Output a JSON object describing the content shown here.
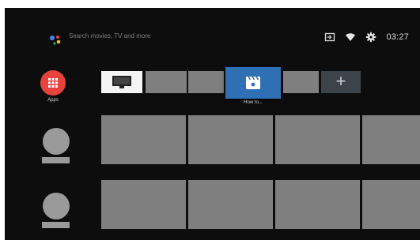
{
  "search": {
    "hint": "Search movies, TV and more"
  },
  "status": {
    "time": "03:27"
  },
  "apps": {
    "label": "Apps"
  },
  "favorites": {
    "focused_label": "How to..."
  },
  "icons": [
    "google-assistant-icon",
    "input-icon",
    "wifi-icon",
    "settings-gear-icon",
    "apps-grid-icon",
    "tv-icon",
    "video-app-icon",
    "plus-icon"
  ],
  "colors": {
    "background": "#0d0d0d",
    "apps_red": "#e8423d",
    "focus_blue": "#2f6fb3",
    "placeholder_gray": "#7f7f7f",
    "add_tile": "#3c4349"
  }
}
